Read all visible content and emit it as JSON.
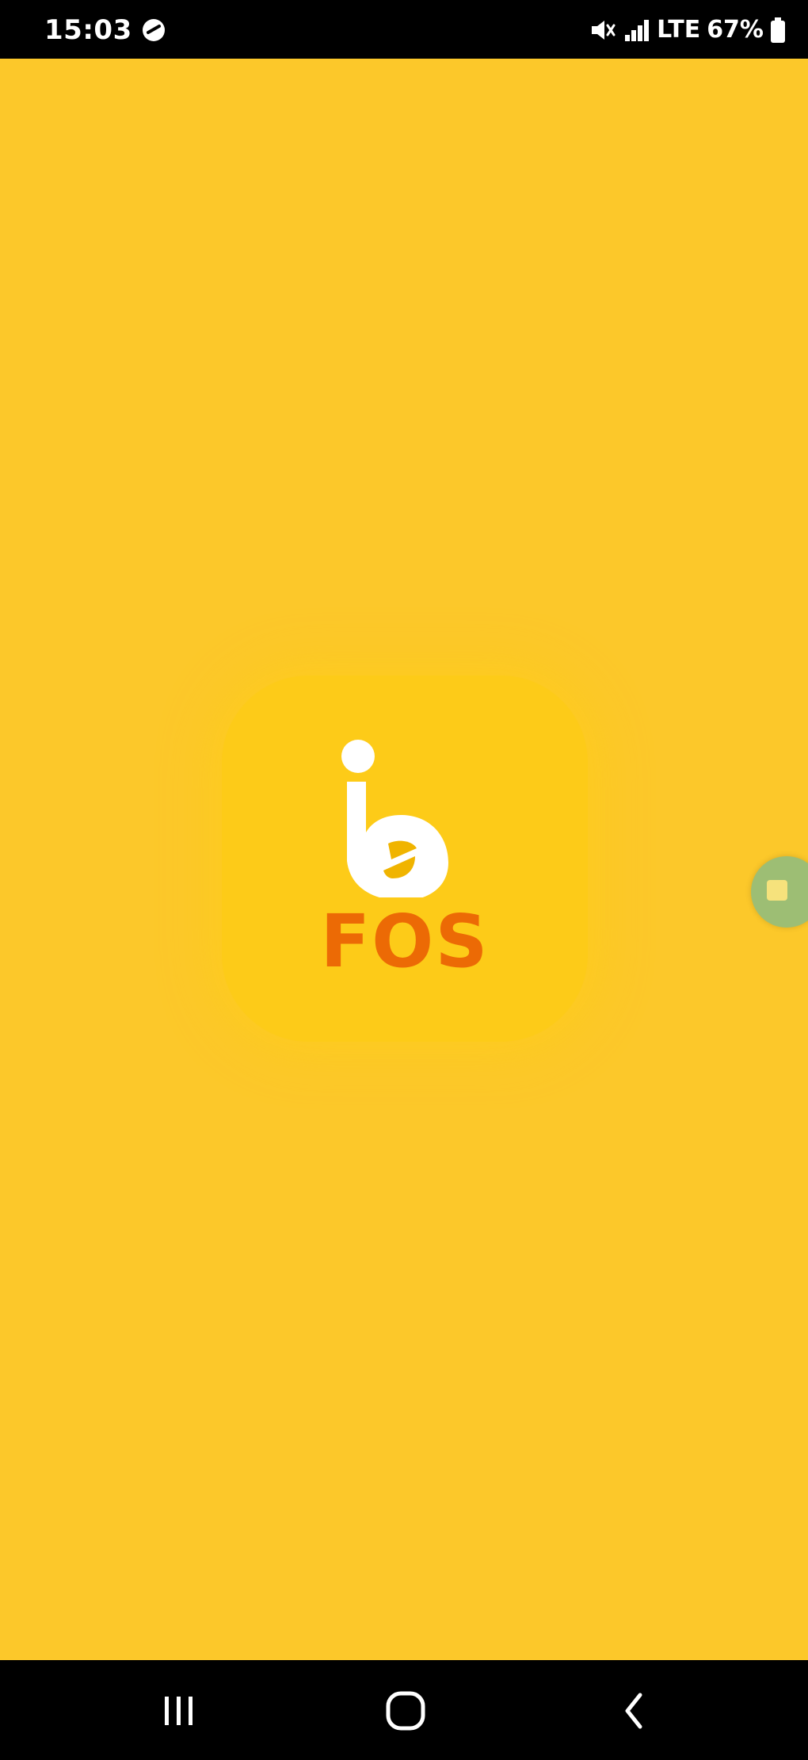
{
  "status_bar": {
    "time": "15:03",
    "network_text": "LTE",
    "battery_text": "67%",
    "icons": {
      "left": "sync-icon",
      "right": [
        "mute-icon",
        "signal-icon",
        "battery-icon"
      ]
    }
  },
  "splash": {
    "logo_text": "FOS",
    "logo_mark": "fos-logo-icon",
    "colors": {
      "background": "#FCC82A",
      "tile": "#FDCB18",
      "logo_text": "#EC6A05",
      "logo_mark": "#FFFFFF"
    }
  },
  "floating_bubble": {
    "icon": "floating-bubble-icon",
    "color": "#9DBE74"
  },
  "navigation_bar": {
    "buttons": [
      "recents-icon",
      "home-icon",
      "back-icon"
    ]
  }
}
